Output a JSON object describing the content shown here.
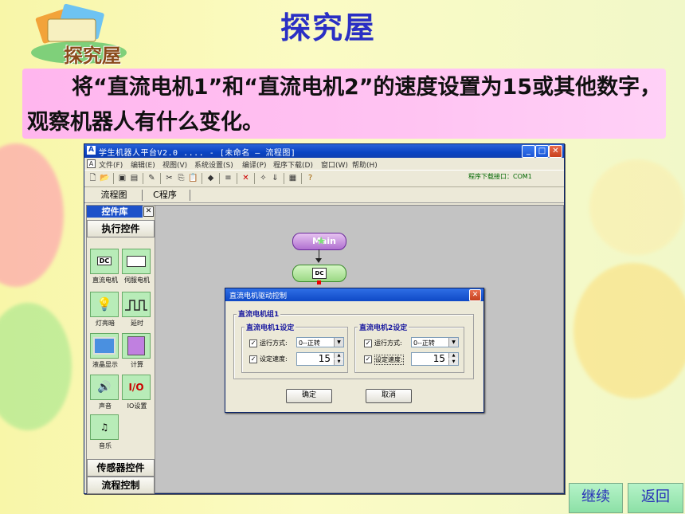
{
  "slide": {
    "logo_text": "探究屋",
    "title": "探究屋",
    "instruction": "将“直流电机1”和“直流电机2”的速度设置为15或其他数字，观察机器人有什么变化。",
    "continue_button": "继续",
    "back_button": "返回"
  },
  "window": {
    "title": "学生机器人平台V2.0 .... - [未命名 — 流程图]",
    "app_icon": "A",
    "menu": [
      "文件(F)",
      "编辑(E)",
      "视图(V)",
      "系统设置(S)",
      "编译(P)",
      "程序下载(D)",
      "窗口(W)",
      "帮助(H)"
    ],
    "port_text": "程序下载接口：COM1",
    "tabs": [
      "流程图",
      "C程序"
    ]
  },
  "library": {
    "header": "控件库",
    "section_execute": "执行控件",
    "controls": [
      {
        "icon": "DC",
        "label": "直流电机"
      },
      {
        "icon": "servo-icon",
        "label": "伺服电机"
      },
      {
        "icon": "bulb-icon",
        "label": "灯亮暗"
      },
      {
        "icon": "delay-icon",
        "label": "延时"
      },
      {
        "icon": "monitor-icon",
        "label": "液晶显示"
      },
      {
        "icon": "calc-icon",
        "label": "计算"
      },
      {
        "icon": "speaker-icon",
        "label": "声音"
      },
      {
        "icon": "I/O",
        "label": "IO设置"
      },
      {
        "icon": "music-icon",
        "label": "音乐"
      }
    ],
    "section_sensor": "传感器控件",
    "section_flow": "流程控制"
  },
  "canvas": {
    "main_node": "Main",
    "dc_node": "DC"
  },
  "dialog": {
    "title": "直流电机驱动控制",
    "group_title": "直流电机组1",
    "motor1": {
      "title": "直流电机1设定",
      "mode_label": "运行方式:",
      "mode_value": "0--正转",
      "speed_label": "设定速度:",
      "speed_value": "15"
    },
    "motor2": {
      "title": "直流电机2设定",
      "mode_label": "运行方式:",
      "mode_value": "0--正转",
      "speed_label": "设定速度:",
      "speed_value": "15"
    },
    "ok_button": "确定",
    "cancel_button": "取消"
  }
}
